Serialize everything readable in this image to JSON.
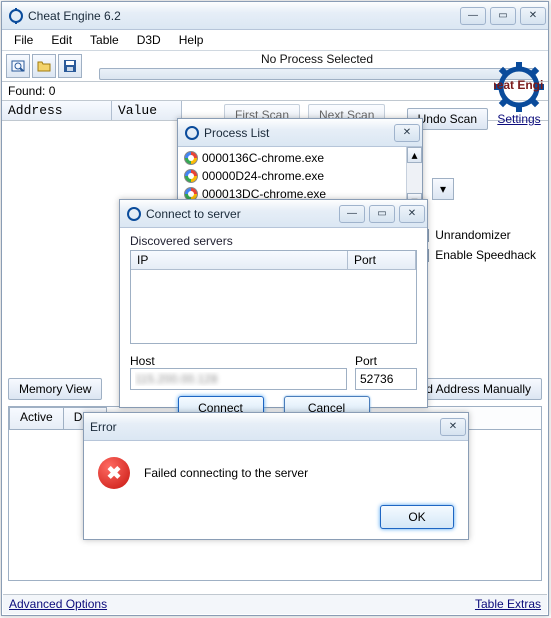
{
  "main": {
    "title": "Cheat Engine 6.2",
    "menu": [
      "File",
      "Edit",
      "Table",
      "D3D",
      "Help"
    ],
    "no_process": "No Process Selected",
    "found": "Found: 0",
    "cols": {
      "address": "Address",
      "value": "Value"
    },
    "buttons": {
      "first_scan": "First Scan",
      "next_scan": "Next Scan",
      "undo_scan": "Undo Scan",
      "memory_view": "Memory View",
      "add_address": "Add Address Manually"
    },
    "settings": "Settings",
    "brand": "Cheat Engine",
    "checks": {
      "unrandomizer": "Unrandomizer",
      "speedhack": "Enable Speedhack"
    },
    "tabs": [
      "Active",
      "Description"
    ],
    "status": {
      "advanced": "Advanced Options",
      "extras": "Table Extras"
    }
  },
  "proclist": {
    "title": "Process List",
    "items": [
      "0000136C-chrome.exe",
      "00000D24-chrome.exe",
      "000013DC-chrome.exe"
    ]
  },
  "connect": {
    "title": "Connect to server",
    "discovered": "Discovered servers",
    "cols": {
      "ip": "IP",
      "port": "Port"
    },
    "host_label": "Host",
    "port_label": "Port",
    "host_value": "115.200.00.128",
    "port_value": "52736",
    "connect_btn": "Connect",
    "cancel_btn": "Cancel"
  },
  "error": {
    "title": "Error",
    "message": "Failed connecting to the server",
    "ok": "OK"
  }
}
